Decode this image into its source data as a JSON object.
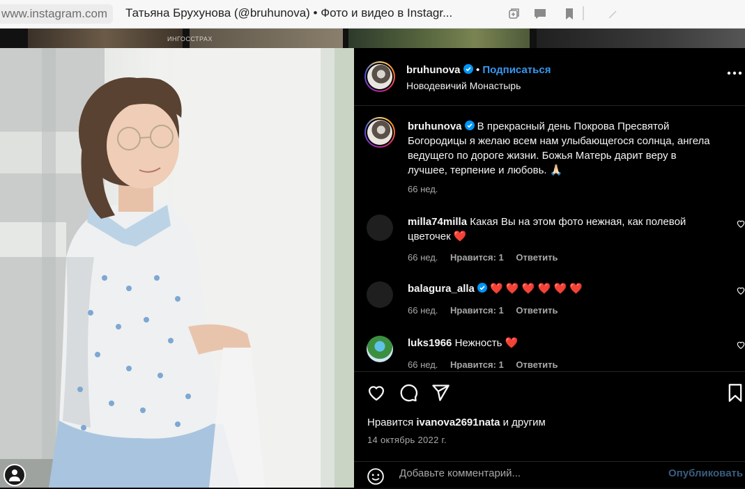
{
  "browser": {
    "url": "www.instagram.com",
    "tab_title": "Татьяна Брухунова (@bruhunova) • Фото и видео в Instagr..."
  },
  "background_page": {
    "banner_text": "ИНГОССТРАХ"
  },
  "post": {
    "username": "bruhunova",
    "follow_label": "Подписаться",
    "location": "Новодевичий Монастырь",
    "caption": {
      "username": "bruhunova",
      "lines": [
        "В прекрасный день Покрова Пресвятой",
        "Богородицы я желаю всем нам улыбающегося солнца, ангела",
        "ведущего по дороге жизни. Божья Матерь дарит веру в",
        "лучшее, терпение и любовь. 🙏🏻"
      ],
      "time": "66 нед."
    },
    "comments": [
      {
        "username": "milla74milla",
        "lines": [
          "Какая Вы на этом фото нежная, как полевой",
          "цветочек ❤️"
        ],
        "time": "66 нед.",
        "likes": "Нравится: 1",
        "reply": "Ответить"
      },
      {
        "username": "balagura_alla",
        "lines": [
          "❤️ ❤️ ❤️ ❤️ ❤️ ❤️"
        ],
        "time": "66 нед.",
        "likes": "Нравится: 1",
        "reply": "Ответить"
      },
      {
        "username": "luks1966",
        "lines": [
          "Нежность ❤️"
        ],
        "time": "66 нед.",
        "likes": "Нравится: 1",
        "reply": "Ответить"
      }
    ],
    "likes_prefix": "Нравится",
    "likes_user": "ivanova2691nata",
    "likes_suffix": "и другим",
    "date": "14 октябрь 2022 г.",
    "comment_placeholder": "Добавьте комментарий...",
    "publish_label": "Опубликовать"
  },
  "colors": {
    "verified": "#0095f6",
    "link": "#3897f0",
    "heart": "#ff3040",
    "panel_bg": "#000000"
  },
  "icons": [
    "copy-icon",
    "feedback-icon",
    "bookmark-icon",
    "heart-icon",
    "comment-icon",
    "share-icon",
    "save-icon",
    "emoji-icon",
    "more-icon",
    "verified-icon"
  ]
}
